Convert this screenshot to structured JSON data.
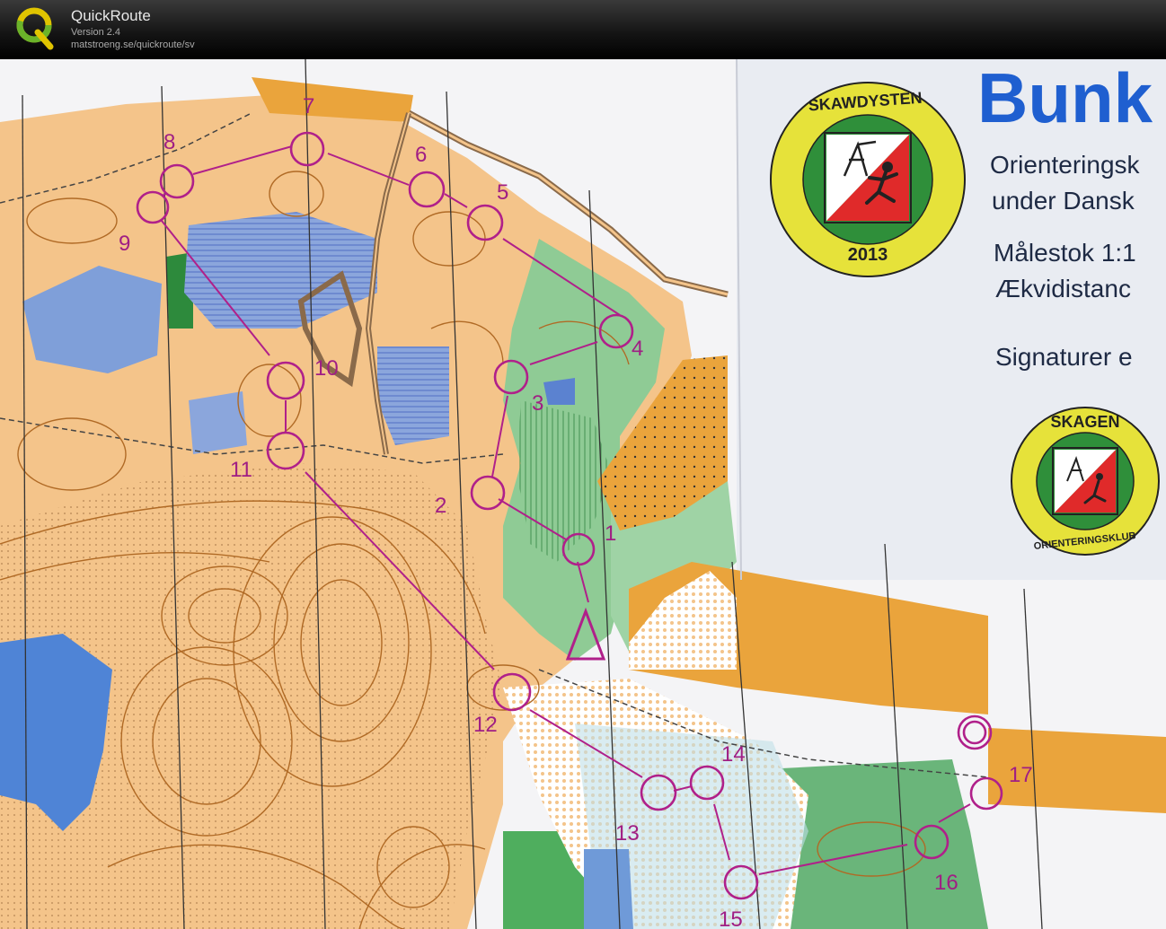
{
  "app": {
    "name": "QuickRoute",
    "version": "Version 2.4",
    "url": "matstroeng.se/quickroute/sv"
  },
  "map": {
    "title": "Bunk",
    "info_lines": [
      "Orienteringsk",
      "under Dansk",
      "Målestok 1:1",
      "Ækvidistanc",
      "Signaturer e"
    ],
    "logo_top": {
      "text": "SKAWDYSTEN",
      "year": "2013"
    },
    "logo_bottom": {
      "top_text": "SKAGEN",
      "bottom_text": "ORIENTERINGSKLUB"
    },
    "control_numbers": [
      "1",
      "2",
      "3",
      "4",
      "5",
      "6",
      "7",
      "8",
      "9",
      "10",
      "11",
      "12",
      "13",
      "14",
      "15",
      "16",
      "17"
    ],
    "colors": {
      "course": "#b0208a",
      "open_land": "#f4c48a",
      "water": "#7f9fd9",
      "forest": "#73b97e",
      "contour": "#b06a25",
      "rough_open": "#e8a03a",
      "paper": "#f4f4f6"
    }
  }
}
